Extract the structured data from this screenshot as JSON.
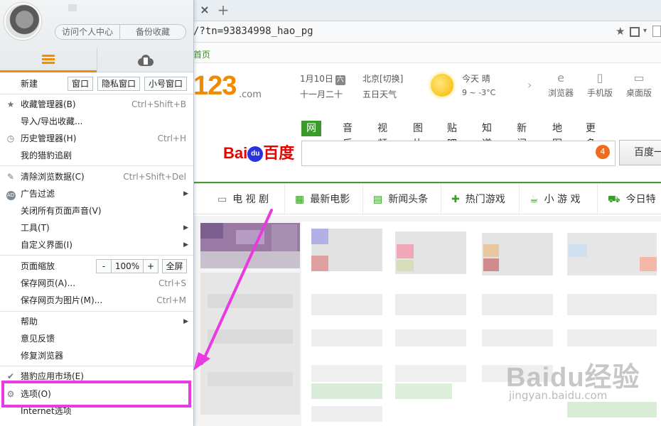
{
  "browser": {
    "tab_close": "×",
    "tab_new": "+",
    "url": "/?tn=93834998_hao_pg",
    "url_star": "★",
    "url_drop": "▾",
    "fav_home": "首页"
  },
  "hao123": {
    "logo": "123",
    "logo_suffix": ".com",
    "date": "1月10日",
    "weekday": "六",
    "lunar": "十一月二十",
    "city": "北京[切换]",
    "five_day": "五日天气",
    "today": "今天 晴",
    "temp": "9 ~ -3°C",
    "quick_links": [
      {
        "icon": "e",
        "label": "浏览器"
      },
      {
        "icon": "▯",
        "label": "手机版"
      },
      {
        "icon": "▭",
        "label": "桌面版"
      }
    ]
  },
  "search": {
    "tabs": [
      "网页",
      "音乐",
      "视频",
      "图片",
      "贴吧",
      "知道",
      "新闻",
      "地图",
      "更多>>"
    ],
    "logo_text_1": "Bai",
    "logo_paw": "du",
    "logo_text_2": "百度",
    "badge": "4",
    "button": "百度一"
  },
  "categories": [
    {
      "icon": "▭",
      "label": "电 视 剧"
    },
    {
      "icon": "▦",
      "label": "最新电影"
    },
    {
      "icon": "▤",
      "label": "新闻头条"
    },
    {
      "icon": "✚",
      "label": "热门游戏"
    },
    {
      "icon": "☕",
      "label": "小 游 戏"
    },
    {
      "icon": "⛟",
      "label": "今日特价"
    }
  ],
  "watermark": {
    "text": "Baidu经验",
    "url": "jingyan.baidu.com"
  },
  "panel": {
    "visit_profile": "访问个人中心",
    "backup_favorites": "备份收藏",
    "new_label": "新建",
    "new_window": "窗口",
    "private_window": "隐私窗口",
    "small_window": "小号窗口",
    "items": [
      {
        "icon": "★",
        "label": "收藏管理器(B)",
        "shortcut": "Ctrl+Shift+B"
      },
      {
        "icon": "",
        "label": "导入/导出收藏...",
        "shortcut": ""
      },
      {
        "icon": "◷",
        "label": "历史管理器(H)",
        "shortcut": "Ctrl+H"
      },
      {
        "icon": "",
        "label": "我的猎豹追剧",
        "shortcut": ""
      },
      {
        "icon": "✎",
        "label": "清除浏览数据(C)",
        "shortcut": "Ctrl+Shift+Del"
      },
      {
        "icon": "AD",
        "label": "广告过滤",
        "shortcut": ""
      },
      {
        "icon": "",
        "label": "关闭所有页面声音(V)",
        "shortcut": ""
      },
      {
        "icon": "",
        "label": "工具(T)",
        "shortcut": ""
      },
      {
        "icon": "",
        "label": "自定义界面(I)",
        "shortcut": ""
      },
      {
        "icon": "",
        "label": "保存网页(A)...",
        "shortcut": "Ctrl+S"
      },
      {
        "icon": "",
        "label": "保存网页为图片(M)...",
        "shortcut": "Ctrl+M"
      },
      {
        "icon": "",
        "label": "帮助",
        "shortcut": ""
      },
      {
        "icon": "",
        "label": "意见反馈",
        "shortcut": ""
      },
      {
        "icon": "",
        "label": "修复浏览器",
        "shortcut": ""
      },
      {
        "icon": "✔",
        "label": "猎豹应用市场(E)",
        "shortcut": ""
      },
      {
        "icon": "⚙",
        "label": "选项(O)",
        "shortcut": ""
      },
      {
        "icon": "",
        "label": "Internet选项",
        "shortcut": ""
      }
    ],
    "zoom": {
      "label": "页面缩放",
      "minus": "-",
      "value": "100%",
      "plus": "+",
      "full": "全屏"
    },
    "submenu_arrow": "▶"
  },
  "colors": {
    "accent_orange": "#f28c00",
    "highlight_magenta": "#e83ae0",
    "baidu_green": "#3a9a2a"
  }
}
